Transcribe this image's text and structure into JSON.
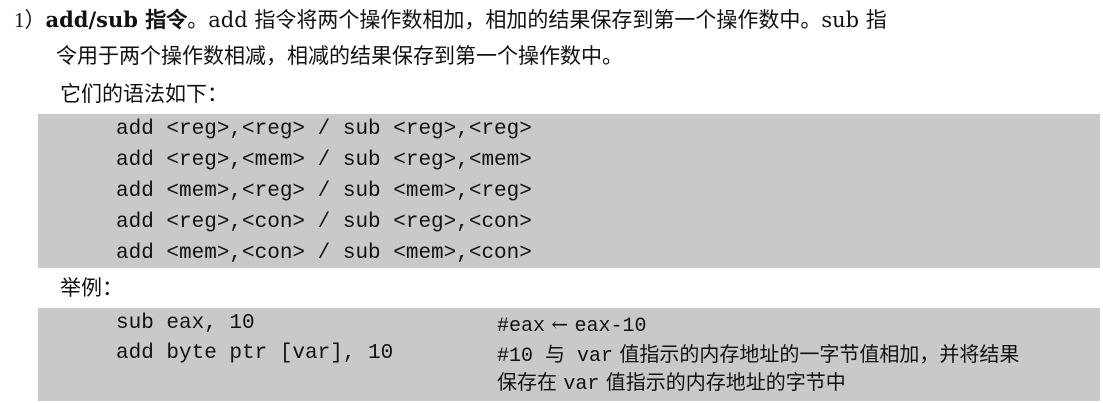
{
  "paragraph": {
    "number": "1）",
    "heading": "add/sub 指令",
    "line1_rest": "。add 指令将两个操作数相加，相加的结果保存到第一个操作数中。sub 指",
    "line2": "令用于两个操作数相减，相减的结果保存到第一个操作数中。",
    "syntax_intro": "它们的语法如下："
  },
  "syntax_lines": [
    "add <reg>,<reg> / sub <reg>,<reg>",
    "add <reg>,<mem> / sub <reg>,<mem>",
    "add <mem>,<reg> / sub <mem>,<reg>",
    "add <reg>,<con> / sub <reg>,<con>",
    "add <mem>,<con> / sub <mem>,<con>"
  ],
  "example_label": "举例：",
  "examples": [
    {
      "code": "sub eax, 10",
      "comment_prefix": "#eax",
      "comment_arrow": "←",
      "comment_suffix": "eax-10"
    },
    {
      "code": "add byte ptr [var], 10",
      "comment_line1_a": "#10 与 ",
      "comment_line1_var": "var",
      "comment_line1_b": " 值指示的内存地址的一字节值相加，并将结果",
      "comment_line2_a": "保存在 ",
      "comment_line2_var": "var",
      "comment_line2_b": " 值指示的内存地址的字节中"
    }
  ]
}
